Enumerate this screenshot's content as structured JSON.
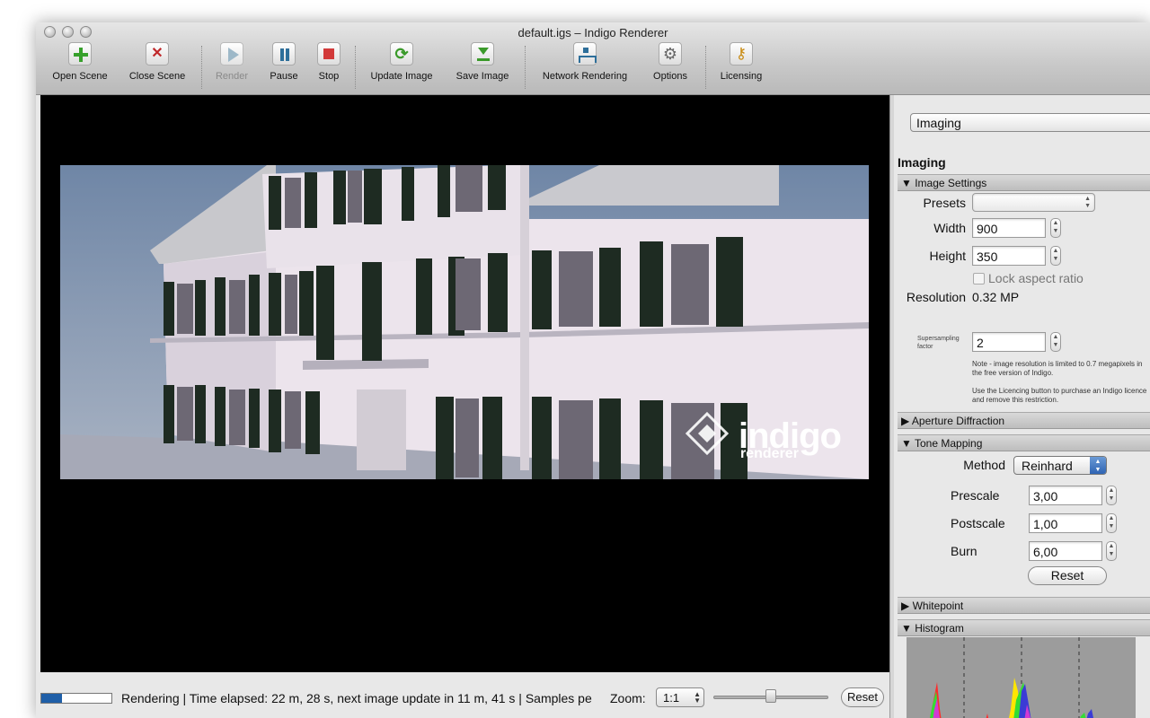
{
  "window": {
    "title": "default.igs – Indigo Renderer"
  },
  "toolbar": {
    "items": [
      {
        "label": "Open Scene",
        "icon": "plus-icon"
      },
      {
        "label": "Close Scene",
        "icon": "close-x-icon"
      },
      {
        "label": "Render",
        "icon": "play-icon"
      },
      {
        "label": "Pause",
        "icon": "pause-icon"
      },
      {
        "label": "Stop",
        "icon": "stop-icon"
      },
      {
        "label": "Update Image",
        "icon": "refresh-icon"
      },
      {
        "label": "Save Image",
        "icon": "download-icon"
      },
      {
        "label": "Network Rendering",
        "icon": "network-icon"
      },
      {
        "label": "Options",
        "icon": "gear-icon"
      },
      {
        "label": "Licensing",
        "icon": "key-icon"
      }
    ]
  },
  "render": {
    "logo_text": "indigo",
    "logo_sub": "renderer"
  },
  "status": {
    "progress_fraction": 0.3,
    "text": "Rendering | Time elapsed: 22 m, 28 s, next image update in 11 m, 41 s | Samples pe",
    "zoom_label": "Zoom:",
    "zoom_value": "1:1",
    "slider_fraction": 0.5,
    "reset_label": "Reset"
  },
  "panel": {
    "selector": "Imaging",
    "heading": "Imaging",
    "image_settings": {
      "header": "Image Settings",
      "presets_label": "Presets",
      "presets_value": "",
      "width_label": "Width",
      "width_value": "900",
      "height_label": "Height",
      "height_value": "350",
      "lock_label": "Lock aspect ratio",
      "resolution_label": "Resolution",
      "resolution_value": "0.32 MP",
      "supersampling_label_1": "Supersampling",
      "supersampling_label_2": "factor",
      "supersampling_value": "2",
      "note_1": "Note - image resolution is limited to 0.7 megapixels in the free version of Indigo.",
      "note_2": "Use the Licencing button to purchase an Indigo licence and remove this restriction."
    },
    "aperture": {
      "header": "Aperture Diffraction"
    },
    "tone_mapping": {
      "header": "Tone Mapping",
      "method_label": "Method",
      "method_value": "Reinhard",
      "prescale_label": "Prescale",
      "prescale_value": "3,00",
      "postscale_label": "Postscale",
      "postscale_value": "1,00",
      "burn_label": "Burn",
      "burn_value": "6,00",
      "reset_label": "Reset"
    },
    "whitepoint": {
      "header": "Whitepoint"
    },
    "histogram": {
      "header": "Histogram"
    }
  }
}
